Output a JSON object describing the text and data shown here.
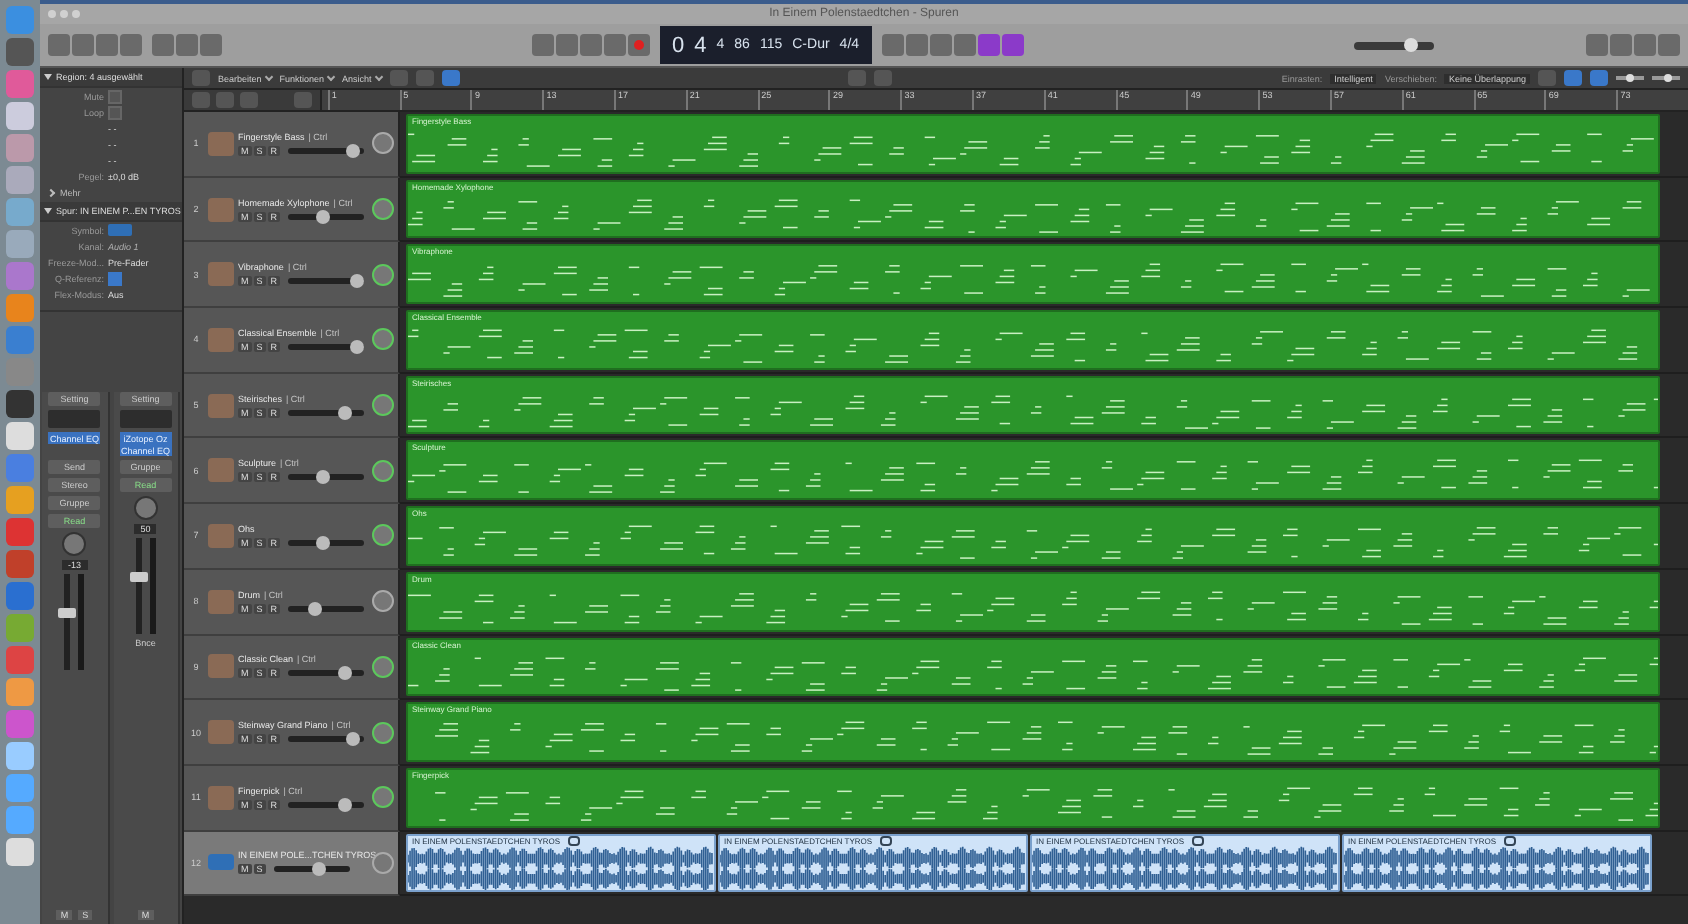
{
  "window": {
    "title": "In Einem Polenstaedtchen - Spuren"
  },
  "lcd": {
    "segments": [
      "0",
      "4",
      "4",
      "86",
      "115",
      "C-Dur",
      "4/4"
    ]
  },
  "master_volume": {
    "level": 0.72
  },
  "menus": [
    "Bearbeiten",
    "Funktionen",
    "Ansicht"
  ],
  "snap": {
    "label": "Einrasten:",
    "value": "Intelligent"
  },
  "drag": {
    "label": "Verschieben:",
    "value": "Keine Überlappung"
  },
  "zoom_sliders": [
    {
      "level": 0.5
    },
    {
      "level": 0.6
    }
  ],
  "ruler": [
    "1",
    "5",
    "9",
    "13",
    "17",
    "21",
    "25",
    "29",
    "33",
    "37",
    "41",
    "45",
    "49",
    "53",
    "57",
    "61",
    "65",
    "69",
    "73"
  ],
  "inspector": {
    "region_header": "Region: 4 ausgewählt",
    "region_fields": [
      {
        "kind": "check",
        "label": "Mute",
        "checked": false
      },
      {
        "kind": "check",
        "label": "Loop",
        "checked": false
      },
      {
        "kind": "text",
        "value": "- -"
      },
      {
        "kind": "text",
        "value": "- -"
      },
      {
        "kind": "text",
        "value": "- -"
      },
      {
        "kind": "value",
        "label": "Pegel:",
        "value": "±0,0 dB"
      }
    ],
    "more": "Mehr",
    "track_header": "Spur: IN EINEM P...EN TYROS",
    "track_fields": [
      {
        "kind": "symbol",
        "label": "Symbol:"
      },
      {
        "kind": "select",
        "label": "Kanal:",
        "value": "Audio 1",
        "disabled": true
      },
      {
        "kind": "select",
        "label": "Freeze-Mod...",
        "value": "Pre-Fader",
        "disabled": false
      },
      {
        "kind": "check",
        "label": "Q-Referenz:",
        "checked": true
      },
      {
        "kind": "select",
        "label": "Flex-Modus:",
        "value": "Aus",
        "disabled": false
      }
    ]
  },
  "strips": [
    {
      "setting": "Setting",
      "plugins": [
        "Channel EQ"
      ],
      "send": "Send",
      "output": "Stereo",
      "group": "Gruppe",
      "automation": "Read",
      "pan_value": "-13",
      "level": 0.6,
      "buttons": [
        "M",
        "S"
      ]
    },
    {
      "setting": "Setting",
      "plugins": [
        "iZotope Oz",
        "Channel EQ"
      ],
      "group": "Gruppe",
      "automation": "Read",
      "pan_value": "50",
      "level": 0.6,
      "name": "Bnce",
      "buttons": [
        "M"
      ]
    }
  ],
  "tracks": [
    {
      "number": "1",
      "kind": "software",
      "name": "Fingerstyle Bass",
      "suffix": "| Ctrl",
      "buttons": [
        "M",
        "S",
        "R"
      ],
      "level": 0.88,
      "pan_active": false,
      "selected": false,
      "regions": [
        {
          "kind": "midi",
          "name": "Fingerstyle Bass"
        }
      ]
    },
    {
      "number": "2",
      "kind": "software",
      "name": "Homemade Xylophone",
      "suffix": "| Ctrl",
      "buttons": [
        "M",
        "S",
        "R"
      ],
      "level": 0.48,
      "pan_active": true,
      "selected": false,
      "regions": [
        {
          "kind": "midi",
          "name": "Homemade Xylophone"
        }
      ]
    },
    {
      "number": "3",
      "kind": "software",
      "name": "Vibraphone",
      "suffix": "| Ctrl",
      "buttons": [
        "M",
        "S",
        "R"
      ],
      "level": 0.92,
      "pan_active": true,
      "selected": false,
      "regions": [
        {
          "kind": "midi",
          "name": "Vibraphone"
        }
      ]
    },
    {
      "number": "4",
      "kind": "software",
      "name": "Classical Ensemble",
      "suffix": "| Ctrl",
      "buttons": [
        "M",
        "S",
        "R"
      ],
      "level": 0.92,
      "pan_active": true,
      "selected": false,
      "regions": [
        {
          "kind": "midi",
          "name": "Classical Ensemble"
        }
      ]
    },
    {
      "number": "5",
      "kind": "software",
      "name": "Steirisches",
      "suffix": "| Ctrl",
      "buttons": [
        "M",
        "S",
        "R"
      ],
      "level": 0.76,
      "pan_active": true,
      "selected": false,
      "regions": [
        {
          "kind": "midi",
          "name": "Steirisches"
        }
      ]
    },
    {
      "number": "6",
      "kind": "software",
      "name": "Sculpture",
      "suffix": "| Ctrl",
      "buttons": [
        "M",
        "S",
        "R"
      ],
      "level": 0.48,
      "pan_active": true,
      "selected": false,
      "regions": [
        {
          "kind": "midi",
          "name": "Sculpture"
        }
      ]
    },
    {
      "number": "7",
      "kind": "software",
      "name": "Ohs",
      "buttons": [
        "M",
        "S",
        "R"
      ],
      "level": 0.48,
      "pan_active": true,
      "selected": false,
      "regions": [
        {
          "kind": "midi",
          "name": "Ohs"
        }
      ]
    },
    {
      "number": "8",
      "kind": "software",
      "name": "Drum",
      "suffix": "| Ctrl",
      "buttons": [
        "M",
        "S",
        "R"
      ],
      "level": 0.38,
      "pan_active": false,
      "selected": false,
      "regions": [
        {
          "kind": "midi",
          "name": "Drum"
        }
      ]
    },
    {
      "number": "9",
      "kind": "software",
      "name": "Classic Clean",
      "suffix": "| Ctrl",
      "buttons": [
        "M",
        "S",
        "R"
      ],
      "level": 0.76,
      "pan_active": true,
      "selected": false,
      "regions": [
        {
          "kind": "midi",
          "name": "Classic Clean"
        }
      ]
    },
    {
      "number": "10",
      "kind": "software",
      "name": "Steinway Grand Piano",
      "suffix": "| Ctrl",
      "buttons": [
        "M",
        "S",
        "R"
      ],
      "level": 0.86,
      "pan_active": true,
      "selected": false,
      "regions": [
        {
          "kind": "midi",
          "name": "Steinway Grand Piano"
        }
      ]
    },
    {
      "number": "11",
      "kind": "software",
      "name": "Fingerpick",
      "suffix": "| Ctrl",
      "buttons": [
        "M",
        "S",
        "R"
      ],
      "level": 0.76,
      "pan_active": true,
      "selected": false,
      "regions": [
        {
          "kind": "midi",
          "name": "Fingerpick"
        }
      ]
    },
    {
      "number": "12",
      "kind": "audio",
      "name": "IN EINEM POLE...TCHEN TYROS",
      "buttons": [
        "M",
        "S"
      ],
      "level": 0.62,
      "pan_active": false,
      "selected": true,
      "regions": [
        {
          "kind": "audio",
          "name": "IN EINEM POLENSTAEDTCHEN TYROS"
        },
        {
          "kind": "audio",
          "name": "IN EINEM POLENSTAEDTCHEN TYROS"
        },
        {
          "kind": "audio",
          "name": "IN EINEM POLENSTAEDTCHEN TYROS"
        },
        {
          "kind": "audio",
          "name": "IN EINEM POLENSTAEDTCHEN TYROS"
        }
      ]
    }
  ]
}
